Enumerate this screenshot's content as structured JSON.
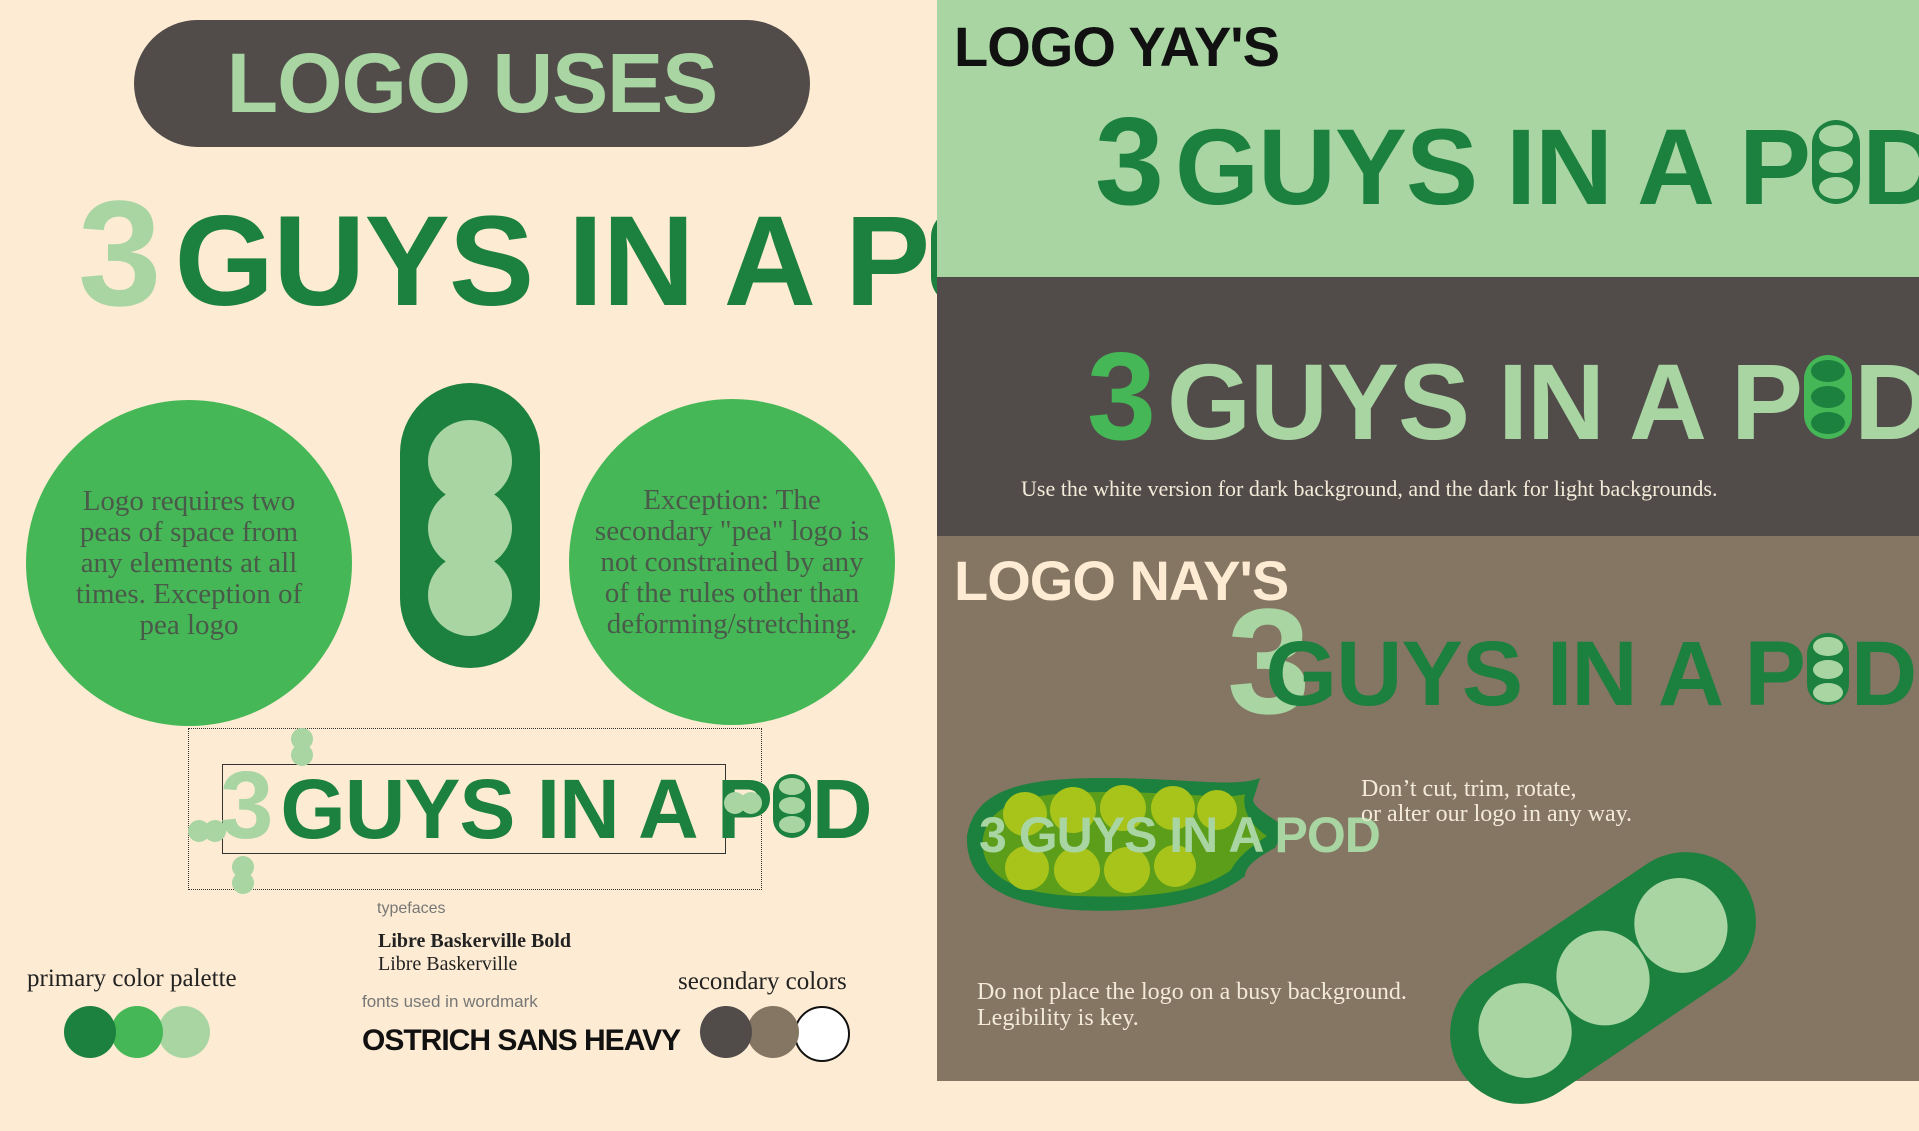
{
  "left": {
    "header": "LOGO USES",
    "wordmark": {
      "three": "3",
      "text": "GUYS IN A P",
      "end": "D"
    },
    "circle_left": "Logo requires two peas of space from any elements at all times. Exception of pea logo",
    "circle_right": "Exception: The secondary \"pea\" logo is not constrained by any of the rules other than deforming/stretching.",
    "typefaces_label": "typefaces",
    "typeface_bold": "Libre Baskerville Bold",
    "typeface_regular": "Libre Baskerville",
    "fonts_label": "fonts used in wordmark",
    "wordmark_font": "OSTRICH SANS HEAVY",
    "primary_label": "primary color palette",
    "secondary_label": "secondary colors",
    "primary_colors": [
      "#1c803e",
      "#46b756",
      "#a8d5a2"
    ],
    "secondary_colors": [
      "#514c4a",
      "#857563",
      "#ffffff"
    ]
  },
  "right": {
    "yays_title": "LOGO YAY'S",
    "dark_note": "Use the white version for dark background, and the dark for light backgrounds.",
    "nays_title": "LOGO NAY'S",
    "busy_logo": "3 GUYS IN A POD",
    "alter_note_1": "Don’t cut, trim, rotate,",
    "alter_note_2": "or alter our logo in any way.",
    "busy_note_1": "Do not place the logo on a busy background.",
    "busy_note_2": "Legibility is key."
  }
}
